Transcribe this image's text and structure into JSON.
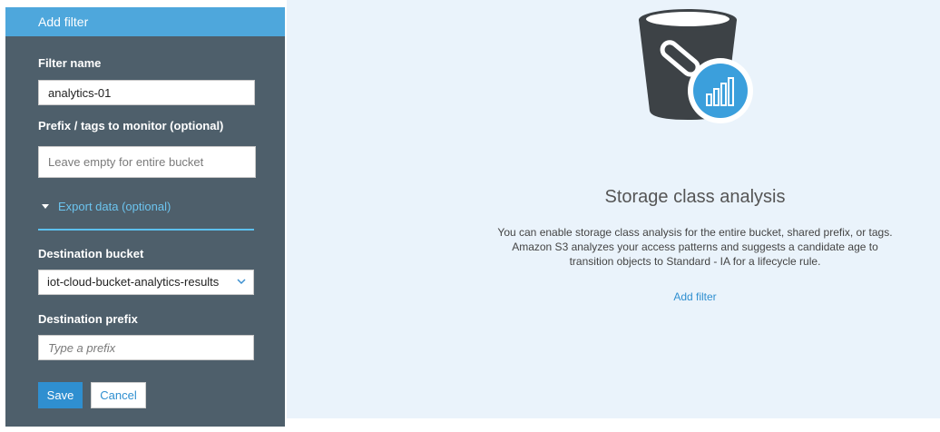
{
  "panel": {
    "header": "Add filter",
    "filter_name": {
      "label": "Filter name",
      "value": "analytics-01"
    },
    "prefix": {
      "label": "Prefix / tags to monitor (optional)",
      "placeholder": "Leave empty for entire bucket"
    },
    "export_toggle": "Export data (optional)",
    "destination_bucket": {
      "label": "Destination bucket",
      "value": "iot-cloud-bucket-analytics-results"
    },
    "destination_prefix": {
      "label": "Destination prefix",
      "placeholder": "Type a prefix"
    },
    "save_label": "Save",
    "cancel_label": "Cancel"
  },
  "main": {
    "illustration_icon": "bucket-analytics-icon",
    "title": "Storage class analysis",
    "description": "You can enable storage class analysis for the entire bucket, shared prefix, or tags. Amazon S3 analyzes your access patterns and suggests a candidate age to transition objects to Standard - IA for a lifecycle rule.",
    "add_filter_link": "Add filter"
  },
  "colors": {
    "panel_bg": "#4e5f6b",
    "header_bg": "#4ea7dc",
    "accent": "#2f8fd0",
    "link_light": "#6cc4ef",
    "content_bg": "#eaf3fb"
  }
}
